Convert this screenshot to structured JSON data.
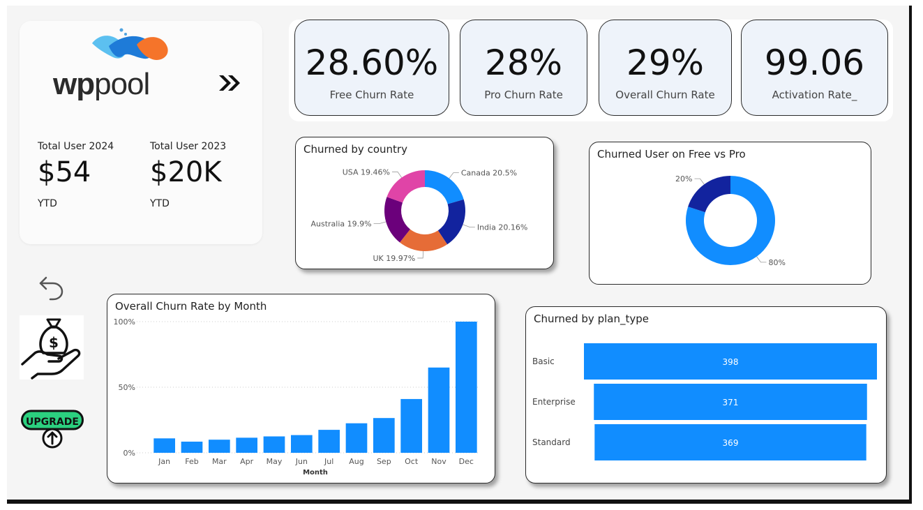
{
  "brand": {
    "name_part1": "wp",
    "name_part2": "pool",
    "next_icon": "double-chevron-right-icon"
  },
  "users": [
    {
      "label": "Total User 2024",
      "value": "$54",
      "sub": "YTD"
    },
    {
      "label": "Total User 2023",
      "value": "$20K",
      "sub": "YTD"
    }
  ],
  "kpis": [
    {
      "value": "28.60%",
      "label": "Free Churn Rate"
    },
    {
      "value": "28%",
      "label": "Pro Churn Rate"
    },
    {
      "value": "29%",
      "label": "Overall Churn Rate"
    },
    {
      "value": "99.06",
      "label": "Activation Rate_"
    }
  ],
  "side_nav": {
    "back_icon": "undo-arrow-icon",
    "money_icon": "money-bag-hand-icon",
    "upgrade_label": "UPGRADE",
    "upgrade_icon": "upgrade-arrow-icon"
  },
  "colors": {
    "primary": "#118DFF",
    "navy": "#12239E",
    "orange": "#E66C37",
    "purple": "#6B007B",
    "pink": "#E044A7",
    "upgrade_green": "#2BD07F"
  },
  "chart_data": [
    {
      "type": "pie",
      "variant": "donut",
      "title": "Churned by country",
      "categories": [
        "Canada",
        "India",
        "UK",
        "Australia",
        "USA"
      ],
      "values": [
        20.5,
        20.16,
        19.97,
        19.9,
        19.46
      ],
      "value_labels": [
        "20.5%",
        "20.16%",
        "19.97%",
        "19.9%",
        "19.46%"
      ],
      "colors": [
        "#118DFF",
        "#12239E",
        "#E66C37",
        "#6B007B",
        "#E044A7"
      ]
    },
    {
      "type": "pie",
      "variant": "donut",
      "title": "Churned User on Free vs Pro",
      "values": [
        80,
        20
      ],
      "value_labels": [
        "80%",
        "20%"
      ],
      "colors": [
        "#118DFF",
        "#12239E"
      ]
    },
    {
      "type": "bar",
      "title": "Overall Churn Rate by Month",
      "xlabel": "Month",
      "categories": [
        "Jan",
        "Feb",
        "Mar",
        "Apr",
        "May",
        "Jun",
        "Jul",
        "Aug",
        "Sep",
        "Oct",
        "Nov",
        "Dec"
      ],
      "values": [
        11,
        8.5,
        10,
        11.5,
        12.5,
        13.5,
        17.5,
        22.5,
        26.5,
        41,
        65,
        100
      ],
      "y_ticks": [
        "0%",
        "50%",
        "100%"
      ],
      "ylim": [
        0,
        100
      ],
      "grid": true,
      "color": "#118DFF"
    },
    {
      "type": "bar",
      "orientation": "horizontal",
      "variant": "funnel",
      "title": "Churned by plan_type",
      "categories": [
        "Basic",
        "Enterprise",
        "Standard"
      ],
      "values": [
        398,
        371,
        369
      ],
      "value_labels": [
        "398",
        "371",
        "369"
      ],
      "color": "#118DFF"
    }
  ]
}
